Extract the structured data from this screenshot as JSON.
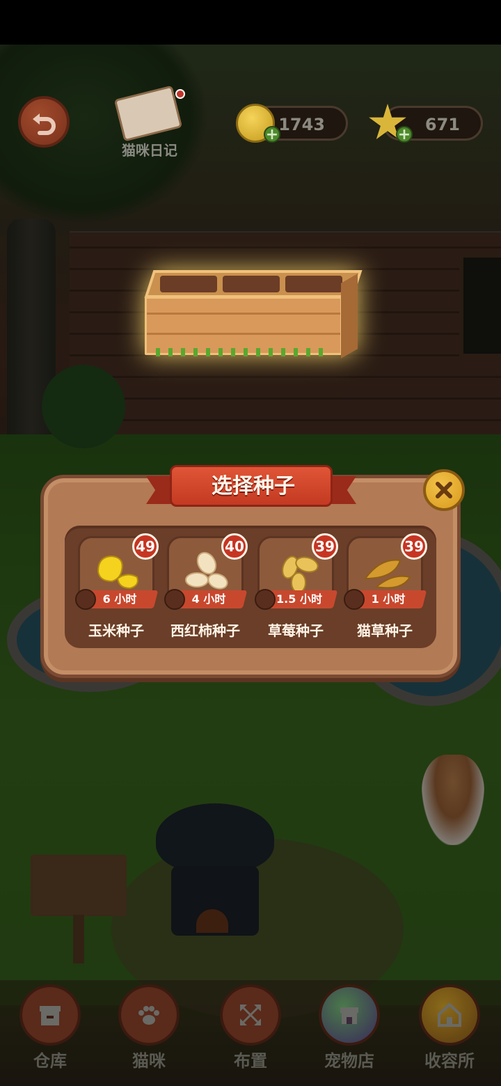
{
  "hud": {
    "diary_label": "猫咪日记",
    "coins": "1743",
    "stars": "671"
  },
  "dialog": {
    "title": "选择种子",
    "seeds": [
      {
        "name": "玉米种子",
        "count": "49",
        "time": "6 小时",
        "icon": "corn-seed-icon"
      },
      {
        "name": "西红柿种子",
        "count": "40",
        "time": "4 小时",
        "icon": "tomato-seed-icon"
      },
      {
        "name": "草莓种子",
        "count": "39",
        "time": "1.5 小时",
        "icon": "strawberry-seed-icon"
      },
      {
        "name": "猫草种子",
        "count": "39",
        "time": "1 小时",
        "icon": "catgrass-seed-icon"
      }
    ]
  },
  "nav": {
    "items": [
      {
        "label": "仓库",
        "icon": "warehouse-icon"
      },
      {
        "label": "猫咪",
        "icon": "paw-icon"
      },
      {
        "label": "布置",
        "icon": "arrange-icon"
      },
      {
        "label": "宠物店",
        "icon": "pet-shop-icon"
      },
      {
        "label": "收容所",
        "icon": "shelter-icon"
      }
    ]
  },
  "colors": {
    "ribbon": "#c33a22",
    "dialog": "#b27a55",
    "count_badge": "#c63522",
    "time_bar": "#c8482e"
  }
}
